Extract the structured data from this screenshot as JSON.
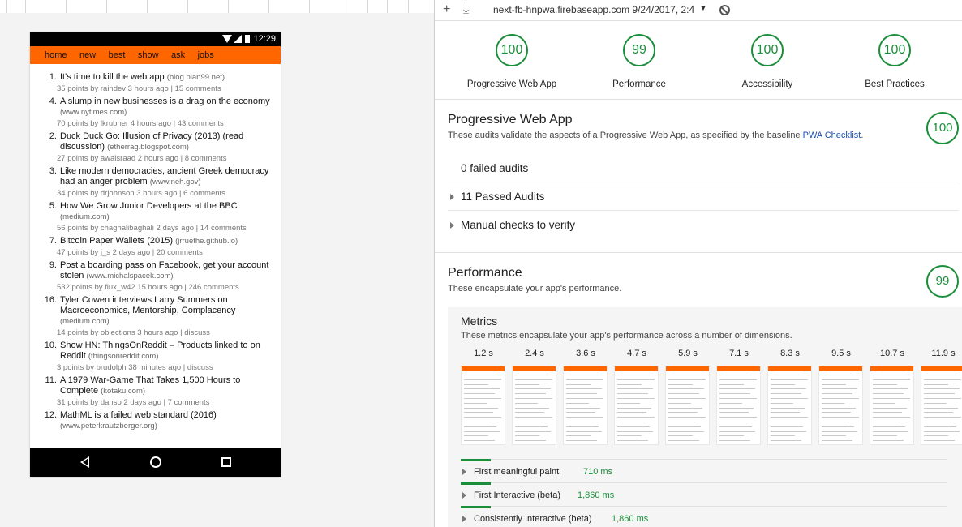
{
  "device": {
    "status_time": "12:29",
    "nav": [
      "home",
      "new",
      "best",
      "show",
      "ask",
      "jobs"
    ],
    "stories": [
      {
        "rank": "1.",
        "title": "It's time to kill the web app",
        "domain": "(blog.plan99.net)",
        "meta": "35 points by raindev 3 hours ago | 15 comments"
      },
      {
        "rank": "4.",
        "title": "A slump in new businesses is a drag on the economy",
        "domain": "(www.nytimes.com)",
        "meta": "70 points by lkrubner 4 hours ago | 43 comments"
      },
      {
        "rank": "2.",
        "title": "Duck Duck Go: Illusion of Privacy (2013) (read discussion)",
        "domain": "(etherrag.blogspot.com)",
        "meta": "27 points by awaisraad 2 hours ago | 8 comments"
      },
      {
        "rank": "3.",
        "title": "Like modern democracies, ancient Greek democracy had an anger problem",
        "domain": "(www.neh.gov)",
        "meta": "34 points by drjohnson 3 hours ago | 6 comments"
      },
      {
        "rank": "5.",
        "title": "How We Grow Junior Developers at the BBC",
        "domain": "(medium.com)",
        "meta": "56 points by chaghalibaghali 2 days ago | 14 comments"
      },
      {
        "rank": "7.",
        "title": "Bitcoin Paper Wallets (2015)",
        "domain": "(jrruethe.github.io)",
        "meta": "47 points by j_s 2 days ago | 20 comments"
      },
      {
        "rank": "9.",
        "title": "Post a boarding pass on Facebook, get your account stolen",
        "domain": "(www.michalspacek.com)",
        "meta": "532 points by flux_w42 15 hours ago | 246 comments"
      },
      {
        "rank": "16.",
        "title": "Tyler Cowen interviews Larry Summers on Macroeconomics, Mentorship, Complacency",
        "domain": "(medium.com)",
        "meta": "14 points by objections 3 hours ago | discuss"
      },
      {
        "rank": "10.",
        "title": "Show HN: ThingsOnReddit – Products linked to on Reddit",
        "domain": "(thingsonreddit.com)",
        "meta": "3 points by brudolph 38 minutes ago | discuss"
      },
      {
        "rank": "11.",
        "title": "A 1979 War-Game That Takes 1,500 Hours to Complete",
        "domain": "(kotaku.com)",
        "meta": "31 points by danso 2 days ago | 7 comments"
      },
      {
        "rank": "12.",
        "title": "MathML is a failed web standard (2016)",
        "domain": "(www.peterkrautzberger.org)",
        "meta": ""
      }
    ]
  },
  "toolbar": {
    "url": "next-fb-hnpwa.firebaseapp.com 9/24/2017, 2:4",
    "add_icon": "+",
    "download_icon": "⤓",
    "caret": "▼"
  },
  "summary": [
    {
      "score": "100",
      "label": "Progressive Web App"
    },
    {
      "score": "99",
      "label": "Performance"
    },
    {
      "score": "100",
      "label": "Accessibility"
    },
    {
      "score": "100",
      "label": "Best Practices"
    }
  ],
  "pwa": {
    "title": "Progressive Web App",
    "desc_prefix": "These audits validate the aspects of a Progressive Web App, as specified by the baseline ",
    "desc_link": "PWA Checklist",
    "desc_suffix": ".",
    "score": "100",
    "groups": [
      "0 failed audits",
      "11 Passed Audits",
      "Manual checks to verify"
    ]
  },
  "performance": {
    "title": "Performance",
    "desc": "These encapsulate your app's performance.",
    "score": "99",
    "metrics_title": "Metrics",
    "metrics_desc": "These metrics encapsulate your app's performance across a number of dimensions.",
    "frame_times": [
      "1.2 s",
      "2.4 s",
      "3.6 s",
      "4.7 s",
      "5.9 s",
      "7.1 s",
      "8.3 s",
      "9.5 s",
      "10.7 s",
      "11.9 s"
    ],
    "metrics": [
      {
        "name": "First meaningful paint",
        "value": "710 ms"
      },
      {
        "name": "First Interactive (beta)",
        "value": "1,860 ms"
      },
      {
        "name": "Consistently Interactive (beta)",
        "value": "1,860 ms"
      }
    ]
  },
  "colors": {
    "accent_green": "#1b8e3b",
    "hn_orange": "#ff6600",
    "link_blue": "#1a4fb4"
  }
}
